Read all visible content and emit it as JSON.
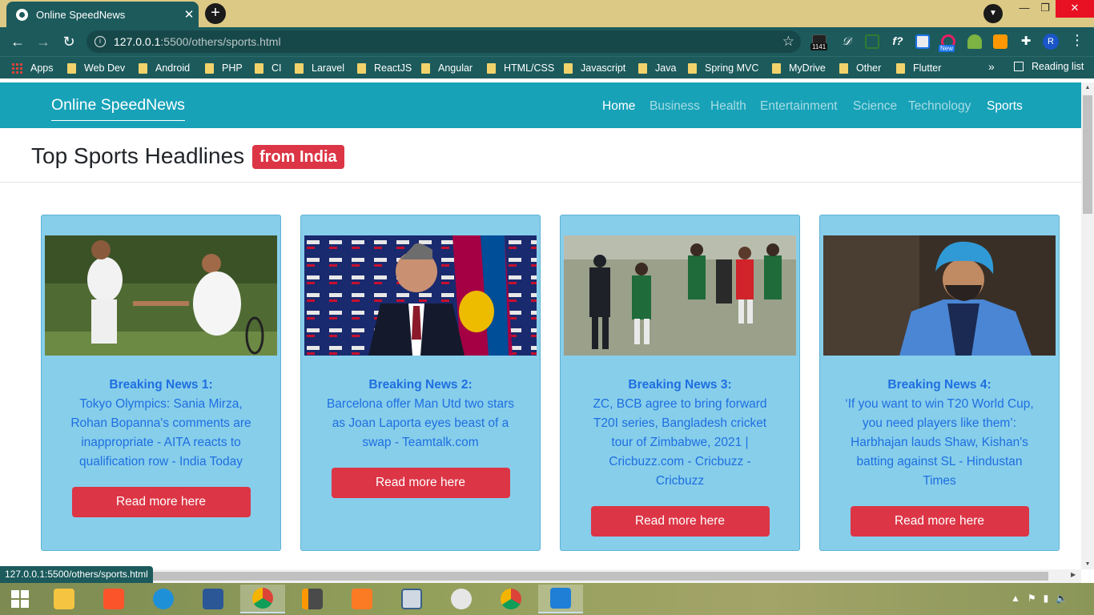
{
  "browser": {
    "tab_title": "Online SpeedNews",
    "tab_close": "✕",
    "new_tab": "+",
    "url_host": "127.0.0.1",
    "url_path": ":5500/others/sports.html",
    "extension_badge": "1141",
    "extension_new": "New",
    "profile_initial": "R",
    "status_url": "127.0.0.1:5500/others/sports.html",
    "window_min": "—",
    "window_max": "❐",
    "window_close": "✕"
  },
  "bookmarks": {
    "apps": "Apps",
    "items": [
      "Web Dev",
      "Android",
      "PHP",
      "CI",
      "Laravel",
      "ReactJS",
      "Angular",
      "HTML/CSS",
      "Javascript",
      "Java",
      "Spring MVC",
      "MyDrive",
      "Other",
      "Flutter"
    ],
    "more": "»",
    "reading_list": "Reading list"
  },
  "site": {
    "brand": "Online SpeedNews",
    "nav": [
      "Home",
      "Business",
      "Health",
      "Entertainment",
      "Science",
      "Technology",
      "Sports"
    ],
    "headline": "Top Sports Headlines",
    "headline_badge": "from India",
    "accent_color": "#17a2b8",
    "card_color": "#87ceeb",
    "button_color": "#dc3545"
  },
  "cards": [
    {
      "title": "Breaking News 1:",
      "text": "Tokyo Olympics: Sania Mirza, Rohan Bopanna's comments are inappropriate - AITA reacts to qualification row - India Today",
      "button": "Read more here"
    },
    {
      "title": "Breaking News 2:",
      "text": "Barcelona offer Man Utd two stars as Joan Laporta eyes beast of a swap - Teamtalk.com",
      "button": "Read more here"
    },
    {
      "title": "Breaking News 3:",
      "text": "ZC, BCB agree to bring forward T20I series, Bangladesh cricket tour of Zimbabwe, 2021 | Cricbuzz.com - Cricbuzz - Cricbuzz",
      "button": "Read more here"
    },
    {
      "title": "Breaking News 4:",
      "text": "‘If you want to win T20 World Cup, you need players like them’: Harbhajan lauds Shaw, Kishan's batting against SL - Hindustan Times",
      "button": "Read more here"
    }
  ]
}
